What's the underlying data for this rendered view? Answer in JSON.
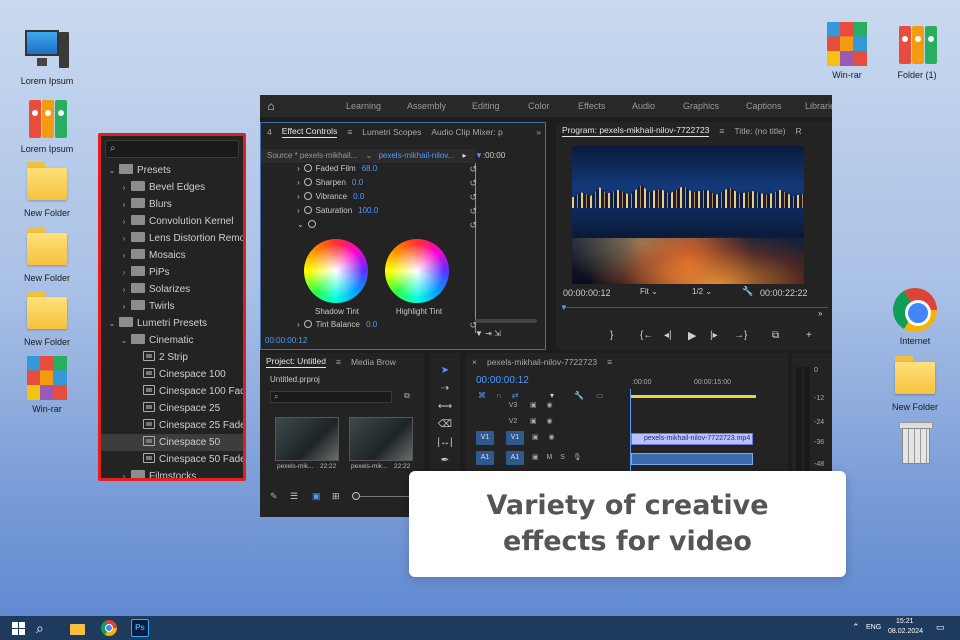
{
  "desktop": {
    "left_icons": [
      {
        "label": "Lorem Ipsum",
        "icon": "monitor-icon"
      },
      {
        "label": "Lorem Ipsum",
        "icon": "binders-icon"
      },
      {
        "label": "New Folder",
        "icon": "folder-icon"
      },
      {
        "label": "New Folder",
        "icon": "folder-icon"
      },
      {
        "label": "New Folder",
        "icon": "folder-icon"
      },
      {
        "label": "Win-rar",
        "icon": "winrar-icon"
      }
    ],
    "right_icons": [
      {
        "label": "Win-rar",
        "icon": "winrar-icon"
      },
      {
        "label": "Folder (1)",
        "icon": "binders-icon"
      },
      {
        "label": "Internet",
        "icon": "chrome-icon"
      },
      {
        "label": "New Folder",
        "icon": "folder-icon"
      },
      {
        "label": "",
        "icon": "recycle-bin-icon"
      }
    ]
  },
  "effects_panel": {
    "search_icon": "magnifier-icon",
    "items": [
      {
        "label": "Presets",
        "level": 0,
        "expanded": true,
        "kind": "folder"
      },
      {
        "label": "Bevel Edges",
        "level": 1,
        "kind": "folder"
      },
      {
        "label": "Blurs",
        "level": 1,
        "kind": "folder"
      },
      {
        "label": "Convolution Kernel",
        "level": 1,
        "kind": "folder"
      },
      {
        "label": "Lens Distortion Remo",
        "level": 1,
        "kind": "folder"
      },
      {
        "label": "Mosaics",
        "level": 1,
        "kind": "folder"
      },
      {
        "label": "PiPs",
        "level": 1,
        "kind": "folder"
      },
      {
        "label": "Solarizes",
        "level": 1,
        "kind": "folder"
      },
      {
        "label": "Twirls",
        "level": 1,
        "kind": "folder"
      },
      {
        "label": "Lumetri Presets",
        "level": 0,
        "expanded": true,
        "kind": "folder"
      },
      {
        "label": "Cinematic",
        "level": 1,
        "expanded": true,
        "kind": "folder"
      },
      {
        "label": "2 Strip",
        "level": 2,
        "kind": "preset"
      },
      {
        "label": "Cinespace 100",
        "level": 2,
        "kind": "preset"
      },
      {
        "label": "Cinespace 100 Fade",
        "level": 2,
        "kind": "preset"
      },
      {
        "label": "Cinespace 25",
        "level": 2,
        "kind": "preset"
      },
      {
        "label": "Cinespace 25 Faded",
        "level": 2,
        "kind": "preset"
      },
      {
        "label": "Cinespace 50",
        "level": 2,
        "kind": "preset",
        "selected": true
      },
      {
        "label": "Cinespace 50 Faded",
        "level": 2,
        "kind": "preset"
      },
      {
        "label": "Filmstocks",
        "level": 1,
        "kind": "folder"
      }
    ]
  },
  "premiere": {
    "workspaces": [
      "Learning",
      "Assembly",
      "Editing",
      "Color",
      "Effects",
      "Audio",
      "Graphics",
      "Captions",
      "Librarie"
    ],
    "effect_controls": {
      "left_edge_tab": "4",
      "tabs": [
        "Effect Controls",
        "Lumetri Scopes",
        "Audio Clip Mixer: p"
      ],
      "source": "Source * pexels-mikhail...",
      "clip": "pexels-mikhail-nilov...",
      "ruler_time": ":00:00",
      "params": [
        {
          "name": "Faded Film",
          "value": "68.0"
        },
        {
          "name": "Sharpen",
          "value": "0.0"
        },
        {
          "name": "Vibrance",
          "value": "0.0"
        },
        {
          "name": "Saturation",
          "value": "100.0"
        }
      ],
      "wheels": [
        "Shadow Tint",
        "Highlight Tint"
      ],
      "tint_balance": {
        "name": "Tint Balance",
        "value": "0.0"
      },
      "timecode": "00:00:00:12"
    },
    "program": {
      "tabs": [
        "Program: pexels-mikhail-nilov-7722723",
        "Title: (no title)",
        "R"
      ],
      "timecode": "00:00:00:12",
      "zoom": "Fit",
      "resolution": "1/2",
      "duration": "00:00:22:22"
    },
    "project": {
      "tabs": [
        "Project: Untitled",
        "Media Brow"
      ],
      "file": "Untitled.prproj",
      "clips": [
        {
          "name": "pexels-mik...",
          "duration": "22:22"
        },
        {
          "name": "pexels-mik...",
          "duration": "22:22"
        }
      ]
    },
    "timeline": {
      "tab": "pexels-mikhail-nilov-7722723",
      "timecode": "00:00:00:12",
      "ruler": [
        ":00:00",
        "00:00:15:00"
      ],
      "tracks": [
        "V3",
        "V2",
        "V1",
        "A1"
      ],
      "source_patch": [
        "V1",
        "A1"
      ],
      "clip_label": "pexels-mikhail-nilov-7722723.mp4 [V]",
      "meter": [
        "0",
        "-12",
        "-24",
        "-36",
        "-48"
      ]
    }
  },
  "caption": [
    "Variety of creative",
    "effects for video"
  ],
  "taskbar": {
    "items": [
      "windows-start-icon",
      "search-icon",
      "file-explorer-icon",
      "chrome-icon",
      "photoshop-icon"
    ],
    "ps_label": "Ps",
    "lang": "ENG",
    "time": "15:21",
    "date": "08.02.2024"
  },
  "colors": {
    "highlight_border": "#e02020",
    "premiere_blue": "#4f9bff",
    "taskbar": "#1e3a5c"
  }
}
